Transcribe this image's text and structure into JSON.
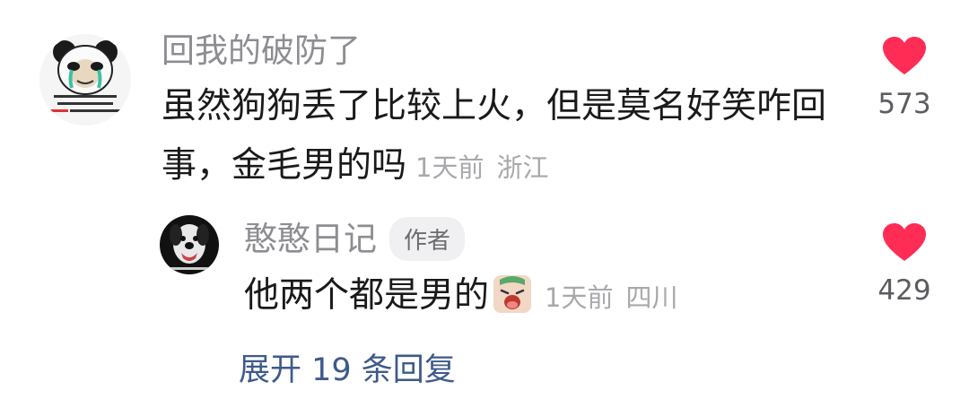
{
  "comment": {
    "username": "回我的破防了",
    "text": "虽然狗狗丢了比较上火，但是莫名好笑咋回事，金毛男的吗",
    "time": "1天前",
    "location": "浙江",
    "likes": "573",
    "avatar": {
      "icon": "panda-meme-avatar",
      "caption_lines": [
        "无论你怎么吠我,",
        "我都不会怪你,",
        "毕竟畜生是没有人性"
      ]
    }
  },
  "reply": {
    "username": "憨憨日记",
    "badge": "作者",
    "text": "他两个都是男的",
    "emoji": "crying-face-emoji",
    "time": "1天前",
    "location": "四川",
    "likes": "429",
    "avatar": {
      "icon": "dog-avatar"
    }
  },
  "expand": {
    "label": "展开 19 条回复"
  },
  "colors": {
    "heart": "#ff2c55",
    "username": "#8d8d92",
    "meta": "#a9a9ad",
    "link": "#3e5a8a"
  }
}
